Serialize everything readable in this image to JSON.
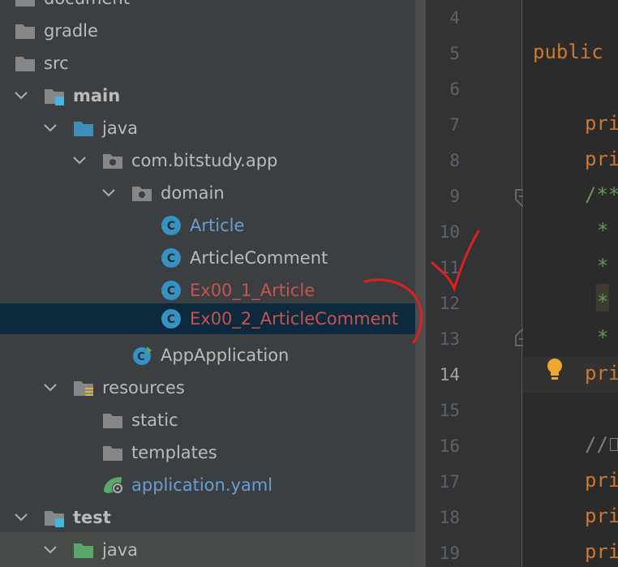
{
  "project_tree": {
    "items": [
      {
        "label": "document"
      },
      {
        "label": "gradle"
      },
      {
        "label": "src"
      },
      {
        "label": "main"
      },
      {
        "label": "java"
      },
      {
        "label": "com.bitstudy.app"
      },
      {
        "label": "domain"
      },
      {
        "label": "Article"
      },
      {
        "label": "ArticleComment"
      },
      {
        "label": "Ex00_1_Article"
      },
      {
        "label": "Ex00_2_ArticleComment"
      },
      {
        "label": "AppApplication"
      },
      {
        "label": "resources"
      },
      {
        "label": "static"
      },
      {
        "label": "templates"
      },
      {
        "label": "application.yaml"
      },
      {
        "label": "test"
      },
      {
        "label": "java"
      }
    ]
  },
  "editor": {
    "line_numbers": [
      "4",
      "5",
      "6",
      "7",
      "8",
      "9",
      "10",
      "11",
      "12",
      "13",
      "14",
      "15",
      "16",
      "17",
      "18",
      "19"
    ],
    "current_line": "14",
    "code": {
      "l5": "public",
      "l7": "pri",
      "l8": "pri",
      "l9": "/**",
      "l10": "*",
      "l11": "*",
      "l12": "*",
      "l13": "*",
      "l14": "pri",
      "l16": "//",
      "l17": "pri",
      "l18": "pri",
      "l19": "pri"
    }
  },
  "colors": {
    "keyword": "#cc7832",
    "doc_comment": "#629755",
    "selection": "#0d293e",
    "annotation": "#e02020"
  }
}
